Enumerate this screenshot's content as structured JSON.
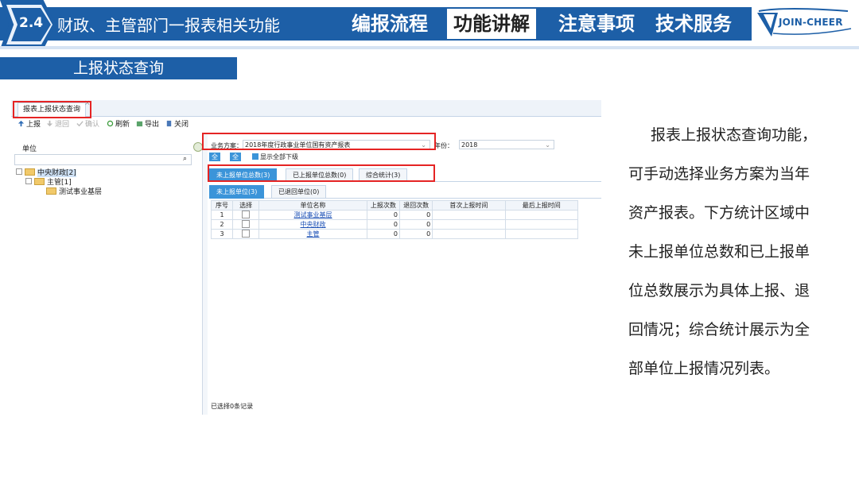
{
  "header": {
    "section_num": "2.4",
    "section_title": "财政、主管部门一报表相关功能",
    "tabs": [
      "编报流程",
      "功能讲解",
      "注意事项",
      "技术服务"
    ],
    "active_tab": "功能讲解",
    "logo_text": "JOIN-CHEER",
    "colors": {
      "band": "#1d5fa7",
      "active_tab_bg": "#ffffff"
    }
  },
  "subtitle": "上报状态查询",
  "app": {
    "tab_label": "报表上报状态查询",
    "toolbar": [
      {
        "label": "上报",
        "icon": "upload-icon",
        "enabled": true
      },
      {
        "label": "退回",
        "icon": "return-icon",
        "enabled": false
      },
      {
        "label": "确认",
        "icon": "confirm-icon",
        "enabled": false
      },
      {
        "label": "刷新",
        "icon": "refresh-icon",
        "enabled": true
      },
      {
        "label": "导出",
        "icon": "export-icon",
        "enabled": true
      },
      {
        "label": "关闭",
        "icon": "close-icon",
        "enabled": true
      }
    ],
    "left": {
      "unit_label": "单位",
      "tree": [
        {
          "label": "中央财政[2]",
          "level": 0
        },
        {
          "label": "主管[1]",
          "level": 1
        },
        {
          "label": "测试事业基层",
          "level": 2
        }
      ]
    },
    "scheme_label": "业务方案：",
    "scheme_value": "2018年度行政事业单位国有资产报表",
    "year_label": "年份：",
    "year_value": "2018",
    "buttons": [
      "全选",
      "全消"
    ],
    "show_all_label": "显示全部下级",
    "stat_tabs": [
      "未上报单位总数(3)",
      "已上报单位总数(0)",
      "综合统计(3)"
    ],
    "sub_tabs": [
      "未上报单位(3)",
      "已退回单位(0)"
    ],
    "columns": [
      "序号",
      "选择",
      "单位名称",
      "上报次数",
      "退回次数",
      "首次上报时间",
      "最后上报时间"
    ],
    "rows": [
      {
        "no": "1",
        "name": "测试事业基层",
        "up": "0",
        "back": "0",
        "first": "",
        "last": ""
      },
      {
        "no": "2",
        "name": "中央财政",
        "up": "0",
        "back": "0",
        "first": "",
        "last": ""
      },
      {
        "no": "3",
        "name": "主管",
        "up": "0",
        "back": "0",
        "first": "",
        "last": ""
      }
    ],
    "footer": "已选择0条记录"
  },
  "description": [
    "报表上报状态查询功能，",
    "可手动选择业务方案为当年",
    "资产报表。下方统计区域中",
    "未上报单位总数和已上报单",
    "位总数展示为具体上报、退",
    "回情况；综合统计展示为全",
    "部单位上报情况列表。"
  ]
}
